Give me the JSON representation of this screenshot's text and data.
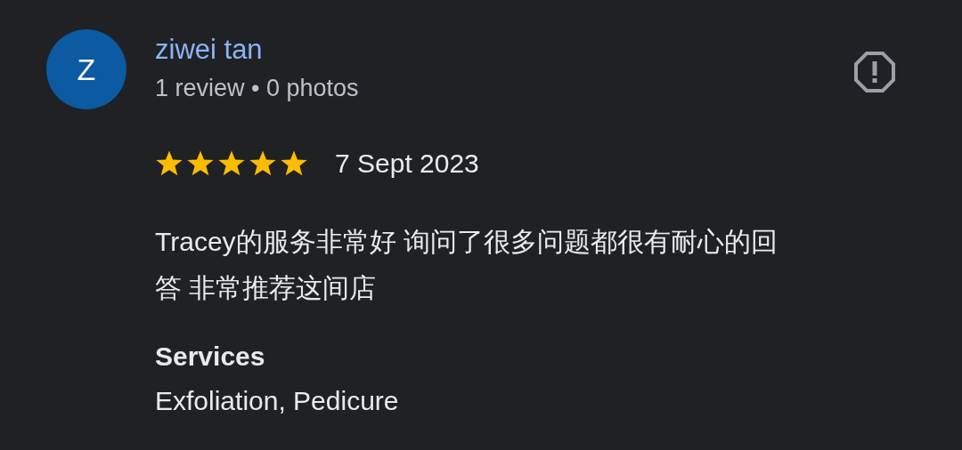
{
  "reviewer": {
    "initial": "Z",
    "name": "ziwei tan",
    "meta": "1 review • 0 photos"
  },
  "review": {
    "stars": 5,
    "date": "7 Sept 2023",
    "text": "Tracey的服务非常好 询问了很多问题都很有耐心的回答 非常推荐这间店"
  },
  "services": {
    "heading": "Services",
    "value": "Exfoliation, Pedicure"
  }
}
